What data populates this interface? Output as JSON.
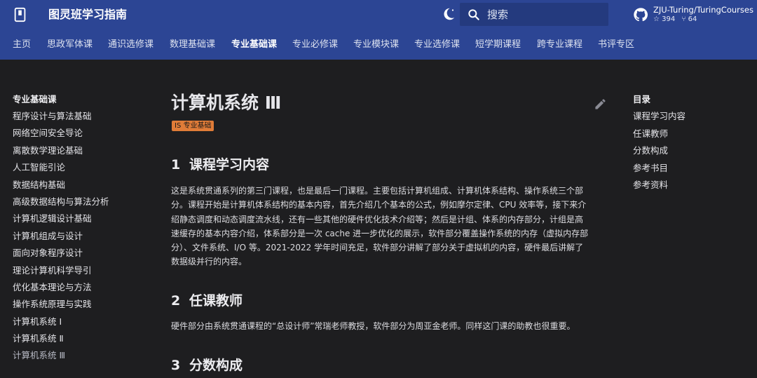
{
  "header": {
    "site_title": "图灵班学习指南",
    "search_placeholder": "搜索",
    "repo_name": "ZJU-Turing/TuringCourses",
    "stars": "394",
    "forks": "64",
    "icons": [
      "book-logo-icon",
      "theme-toggle-icon",
      "search-icon",
      "github-icon",
      "star-icon",
      "fork-icon"
    ],
    "colors": {
      "header_bg": "#2c4594",
      "search_bg": "#243a7e"
    }
  },
  "tabs": [
    {
      "label": "主页",
      "active": false
    },
    {
      "label": "思政军体课",
      "active": false
    },
    {
      "label": "通识选修课",
      "active": false
    },
    {
      "label": "数理基础课",
      "active": false
    },
    {
      "label": "专业基础课",
      "active": true
    },
    {
      "label": "专业必修课",
      "active": false
    },
    {
      "label": "专业模块课",
      "active": false
    },
    {
      "label": "专业选修课",
      "active": false
    },
    {
      "label": "短学期课程",
      "active": false
    },
    {
      "label": "跨专业课程",
      "active": false
    },
    {
      "label": "书评专区",
      "active": false
    }
  ],
  "sidebar": {
    "title": "专业基础课",
    "items": [
      "程序设计与算法基础",
      "网络空间安全导论",
      "离散数学理论基础",
      "人工智能引论",
      "数据结构基础",
      "高级数据结构与算法分析",
      "计算机逻辑设计基础",
      "计算机组成与设计",
      "面向对象程序设计",
      "理论计算机科学导引",
      "优化基本理论与方法",
      "操作系统原理与实践",
      "计算机系统 Ⅰ",
      "计算机系统 Ⅱ",
      "计算机系统 Ⅲ"
    ],
    "active_index": 14
  },
  "article": {
    "title": "计算机系统 Ⅲ",
    "tag": "IS 专业基础",
    "colors": {
      "tag_bg": "#e07c38"
    },
    "sections": [
      {
        "num": "1",
        "title": "课程学习内容",
        "lines": [
          "这是系统贯通系列的第三门课程，也是最后一门课程。主要包括计算机组成、计算机体系结构、操作系统三个部",
          "分。课程开始是计算机体系结构的基本内容，首先介绍几个基本的公式，例如摩尔定律、CPU 效率等，接下来介",
          "绍静态调度和动态调度流水线，还有一些其他的硬件优化技术介绍等；然后是计组、体系的内存部分，计组是高",
          "速缓存的基本内容介绍，体系部分是一次 cache 进一步优化的展示，软件部分覆盖操作系统的内存（虚拟内存部",
          "分）、文件系统、I/O 等。2021-2022 学年时间充足，软件部分讲解了部分关于虚拟机的内容，硬件最后讲解了",
          "数据级并行的内容。"
        ]
      },
      {
        "num": "2",
        "title": "任课教师",
        "lines": [
          "硬件部分由系统贯通课程的“总设计师”常瑞老师教授，软件部分为周亚金老师。同样这门课的助教也很重要。"
        ]
      },
      {
        "num": "3",
        "title": "分数构成",
        "lines": []
      }
    ]
  },
  "toc": {
    "title": "目录",
    "items": [
      "课程学习内容",
      "任课教师",
      "分数构成",
      "参考书目",
      "参考资料"
    ]
  }
}
